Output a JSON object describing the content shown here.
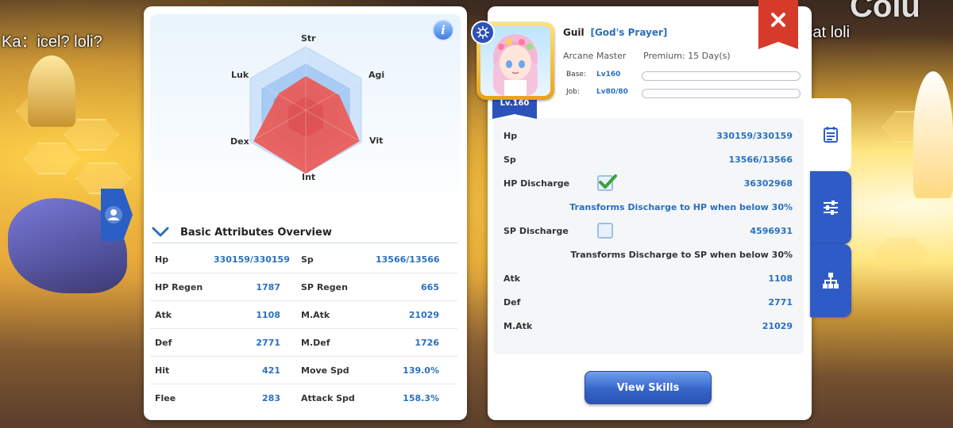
{
  "scene": {
    "chat_left": "Ka：icel? loli?",
    "chat_right": "ravin：cat loli",
    "big_text": "Colu"
  },
  "radar": {
    "labels": {
      "str": "Str",
      "agi": "Agi",
      "vit": "Vit",
      "int": "Int",
      "dex": "Dex",
      "luk": "Luk"
    },
    "info_icon": "i"
  },
  "overview": {
    "title": "Basic Attributes Overview",
    "rows": [
      {
        "l1": "Hp",
        "v1": "330159/330159",
        "l2": "Sp",
        "v2": "13566/13566"
      },
      {
        "l1": "HP Regen",
        "v1": "1787",
        "l2": "SP Regen",
        "v2": "665"
      },
      {
        "l1": "Atk",
        "v1": "1108",
        "l2": "M.Atk",
        "v2": "21029"
      },
      {
        "l1": "Def",
        "v1": "2771",
        "l2": "M.Def",
        "v2": "1726"
      },
      {
        "l1": "Hit",
        "v1": "421",
        "l2": "Move Spd",
        "v2": "139.0%"
      },
      {
        "l1": "Flee",
        "v1": "283",
        "l2": "Attack Spd",
        "v2": "158.3%"
      }
    ]
  },
  "profile": {
    "name": "Guil",
    "guild": "[God's Prayer]",
    "class": "Arcane Master",
    "premium": "Premium: 15 Day(s)",
    "level_badge": "Lv.160",
    "base_label": "Base:",
    "base_level": "Lv160",
    "base_progress": 0,
    "job_label": "Job:",
    "job_level": "Lv80/80",
    "job_progress": 0
  },
  "details": {
    "hp_label": "Hp",
    "hp_value": "330159/330159",
    "sp_label": "Sp",
    "sp_value": "13566/13566",
    "hp_discharge_label": "HP Discharge",
    "hp_discharge_value": "36302968",
    "hp_discharge_checked": true,
    "hp_discharge_note": "Transforms Discharge to HP when below 30%",
    "sp_discharge_label": "SP Discharge",
    "sp_discharge_value": "4596931",
    "sp_discharge_checked": false,
    "sp_discharge_note": "Transforms Discharge to SP when below 30%",
    "atk_label": "Atk",
    "atk_value": "1108",
    "def_label": "Def",
    "def_value": "2771",
    "matk_label": "M.Atk",
    "matk_value": "21029"
  },
  "buttons": {
    "view_skills": "View Skills"
  },
  "colors": {
    "accent_blue": "#2a6fc0",
    "tab_blue": "#2f5bc6",
    "close_red": "#d63a2a",
    "radar_fill": "#ec5a55"
  },
  "icons": {
    "tab1": "calendar-icon",
    "tab2": "sliders-icon",
    "tab3": "hierarchy-icon",
    "close": "close-icon",
    "check": "check-icon",
    "profile_tab": "user-icon",
    "chevron": "chevron-down-icon"
  }
}
